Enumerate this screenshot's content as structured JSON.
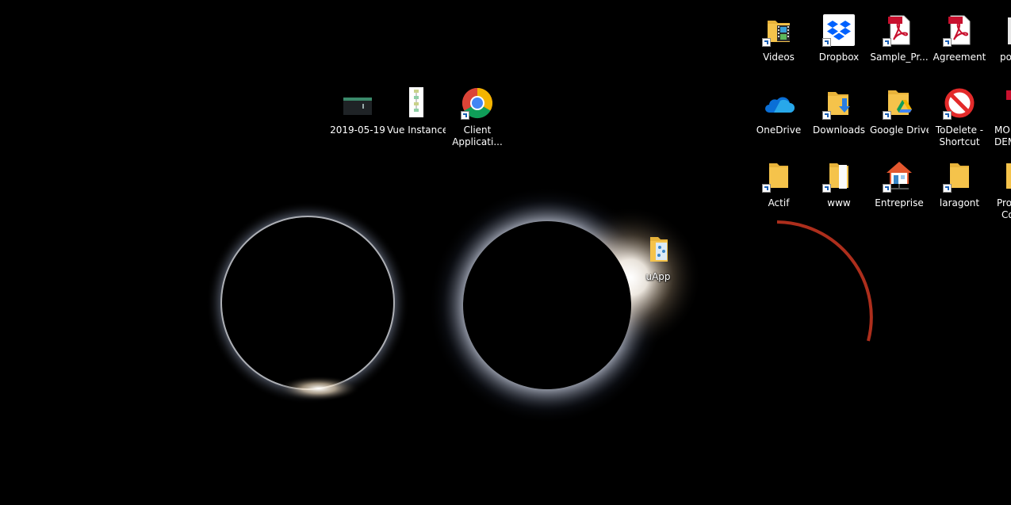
{
  "desktop": {
    "icons": [
      {
        "label": "Videos",
        "icon": "videos-folder-icon"
      },
      {
        "label": "Dropbox",
        "icon": "dropbox-icon"
      },
      {
        "label": "Sample_Pr...",
        "icon": "pdf-icon",
        "badge": "PDF"
      },
      {
        "label": "Agreement",
        "icon": "pdf-icon",
        "badge": "PDF"
      },
      {
        "label": "po",
        "icon": "partial-icon"
      },
      {
        "label": "2019-05-19",
        "icon": "terminal-icon"
      },
      {
        "label": "Vue Instance",
        "icon": "flowchart-document-icon"
      },
      {
        "label": "Client",
        "label2": "Applicati...",
        "icon": "chrome-icon"
      },
      {
        "label": "OneDrive",
        "icon": "onedrive-icon"
      },
      {
        "label": "Downloads",
        "icon": "downloads-folder-icon"
      },
      {
        "label": "Google Drive",
        "icon": "google-drive-folder-icon"
      },
      {
        "label": "ToDelete -",
        "label2": "Shortcut",
        "icon": "prohibited-icon"
      },
      {
        "label": "MO",
        "label2": "DEM",
        "icon": "partial-icon"
      },
      {
        "label": "Actif",
        "icon": "folder-icon"
      },
      {
        "label": "www",
        "icon": "document-folder-icon"
      },
      {
        "label": "Entreprise",
        "icon": "house-network-icon"
      },
      {
        "label": "laragont",
        "icon": "folder-icon"
      },
      {
        "label": "Pro",
        "label2": "Co",
        "icon": "partial-folder-icon"
      },
      {
        "label": "uApp",
        "icon": "zip-folder-icon"
      }
    ]
  },
  "colors": {
    "background": "#000000",
    "folder": "#f5c34b",
    "dropbox": "#0061fe",
    "pdf": "#c8102e",
    "onedrive": "#0a6fd6"
  }
}
